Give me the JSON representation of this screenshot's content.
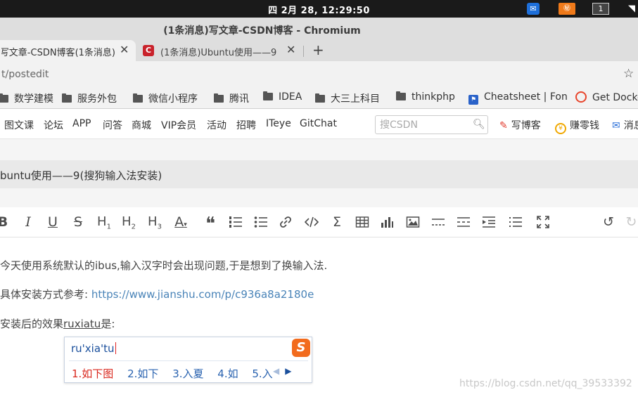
{
  "system": {
    "clock": "四 2月 28, 12:29:50",
    "tray_b": "㊙",
    "tray_c": "1"
  },
  "window": {
    "title": "(1条消息)写文章-CSDN博客 - Chromium"
  },
  "tabs": [
    {
      "label": "(1条消息)写文章-CSDN博客",
      "close": "✕"
    },
    {
      "label": "(1条消息)Ubuntu使用——9",
      "close": "✕",
      "favicon": "C"
    }
  ],
  "new_tab": "+",
  "address": {
    "url": "t/postedit"
  },
  "bookmarks": [
    {
      "label": "数学建模"
    },
    {
      "label": "服务外包"
    },
    {
      "label": "微信小程序"
    },
    {
      "label": "腾讯"
    },
    {
      "label": "IDEA"
    },
    {
      "label": "大三上科目"
    },
    {
      "label": "thinkphp"
    },
    {
      "label": "Cheatsheet | Fon"
    },
    {
      "label": "Get Docker"
    }
  ],
  "csdn_nav": {
    "items": [
      "图文课",
      "论坛",
      "APP",
      "问答",
      "商城",
      "VIP会员",
      "活动",
      "招聘",
      "ITeye",
      "GitChat"
    ],
    "search_placeholder": "搜CSDN",
    "write_blog": "写博客",
    "earn": "赚零钱",
    "messages": "消息"
  },
  "editor": {
    "article_title": "buntu使用——9(搜狗输入法安装)",
    "toolbar_icons": [
      "bold-icon",
      "italic-icon",
      "underline-icon",
      "strikethrough-icon",
      "heading1-icon",
      "heading2-icon",
      "heading3-icon",
      "font-color-icon",
      "quote-icon",
      "ordered-list-icon",
      "unordered-list-icon",
      "link-icon",
      "code-icon",
      "formula-icon",
      "table-icon",
      "chart-icon",
      "image-icon",
      "divider-icon",
      "more-icon",
      "indent-icon",
      "toc-icon",
      "fullscreen-icon",
      "undo-icon",
      "redo-icon"
    ],
    "heading_labels": {
      "h1": "1",
      "h2": "2",
      "h3": "3"
    },
    "para1": "今天使用系统默认的ibus,输入汉字时会出现问题,于是想到了换输入法.",
    "para2_prefix": "具体安装方式参考: ",
    "para2_link": "https://www.jianshu.com/p/c936a8a2180e",
    "para3_prefix": "安装后的效果",
    "para3_underlined": "ruxiatu",
    "para3_suffix": "是:"
  },
  "ime": {
    "composition": "ru'xia'tu",
    "logo_letter": "S",
    "candidates": [
      "1.如下图",
      "2.如下",
      "3.入夏",
      "4.如",
      "5.入"
    ]
  },
  "watermark": "https://blog.csdn.net/qq_39533392"
}
